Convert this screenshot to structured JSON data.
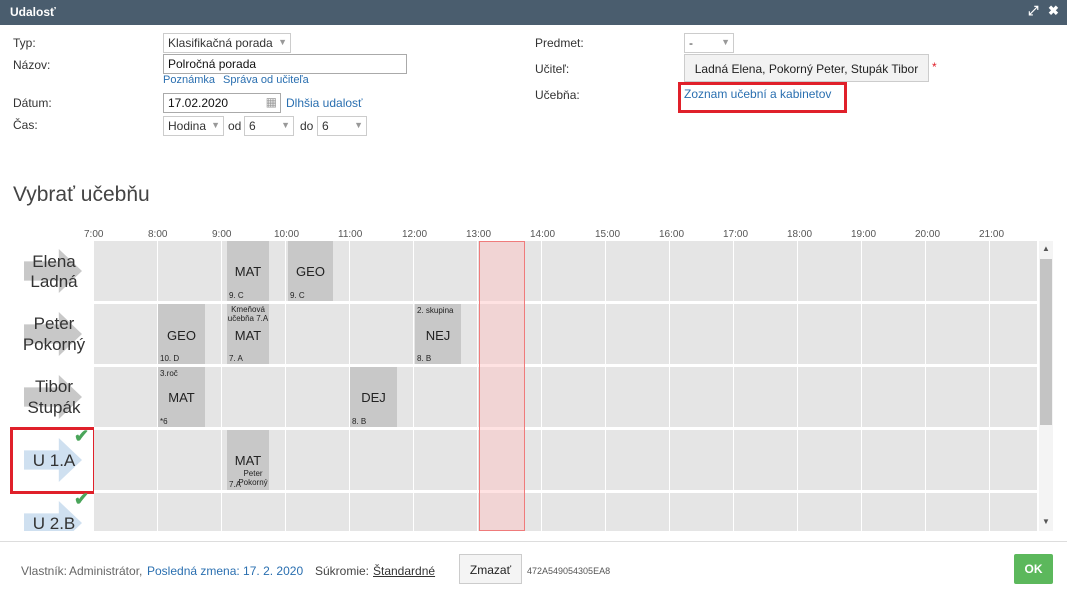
{
  "window": {
    "title": "Udalosť",
    "expand_icon": "expand-icon",
    "close_icon": "close-icon"
  },
  "form": {
    "type_label": "Typ:",
    "type_value": "Klasifikačná porada",
    "name_label": "Názov:",
    "name_value": "Polročná porada",
    "note_link": "Poznámka",
    "teacher_msg_link": "Správa od učiteľa",
    "date_label": "Dátum:",
    "date_value": "17.02.2020",
    "longer_event_link": "Dlhšia udalosť",
    "time_label": "Čas:",
    "time_unit": "Hodina",
    "from_label": "od",
    "from_value": "6",
    "to_label": "do",
    "to_value": "6",
    "subject_label": "Predmet:",
    "subject_value": "-",
    "teacher_label": "Učiteľ:",
    "teacher_value": "Ladná Elena, Pokorný Peter, Stupák Tibor",
    "required_mark": "*",
    "room_label": "Učebňa:",
    "room_link": "Zoznam učební a kabinetov"
  },
  "schedule": {
    "heading": "Vybrať učebňu",
    "hours": [
      "7:00",
      "8:00",
      "9:00",
      "10:00",
      "11:00",
      "12:00",
      "13:00",
      "14:00",
      "15:00",
      "16:00",
      "17:00",
      "18:00",
      "19:00",
      "20:00",
      "21:00"
    ],
    "lanes": [
      {
        "line1": "Elena",
        "line2": "Ladná"
      },
      {
        "line1": "Peter",
        "line2": "Pokorný"
      },
      {
        "line1": "Tibor",
        "line2": "Stupák"
      },
      {
        "line1": "U 1.A",
        "line2": ""
      },
      {
        "line1": "U 2.B",
        "line2": ""
      }
    ],
    "check_icon": "check-icon",
    "events": [
      {
        "name": "MAT",
        "class": "9. C",
        "top": ""
      },
      {
        "name": "GEO",
        "class": "9. C",
        "top": ""
      },
      {
        "name": "GEO",
        "class": "10. D",
        "top": ""
      },
      {
        "name": "MAT",
        "class": "7. A",
        "top": "Kmeňová učebňa 7.A"
      },
      {
        "name": "NEJ",
        "class": "8. B",
        "top": "2. skupina"
      },
      {
        "name": "MAT",
        "class": "*6",
        "top": "3.roč"
      },
      {
        "name": "DEJ",
        "class": "8. B",
        "top": ""
      },
      {
        "name": "MAT",
        "class": "7.A",
        "top": "Peter Pokorný"
      }
    ]
  },
  "footer": {
    "owner_label": "Vlastník:",
    "owner_value": "Administrátor,",
    "last_change_link": "Posledná zmena: 17. 2. 2020",
    "privacy_label": "Súkromie:",
    "privacy_value": "Štandardné",
    "delete_button": "Zmazať",
    "record_id": "472A549054305EA8",
    "ok_button": "OK"
  },
  "colors": {
    "titlebar": "#4a5d6e",
    "link": "#2a6fb0",
    "highlight": "#e0202a",
    "ok": "#5cb85c"
  }
}
